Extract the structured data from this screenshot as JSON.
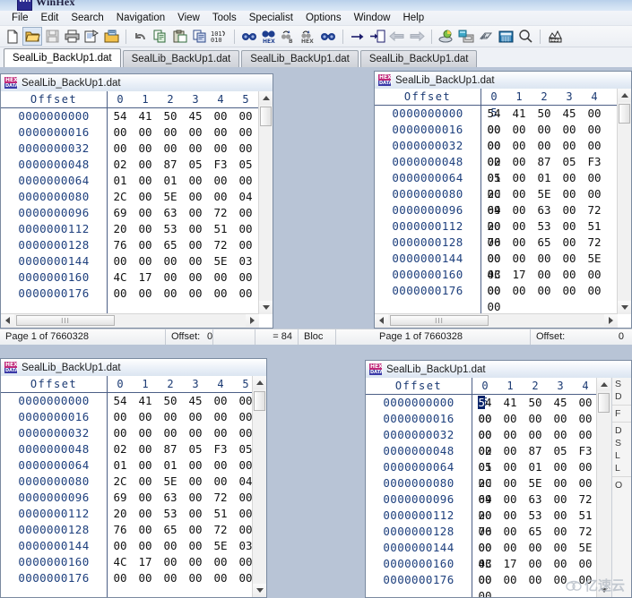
{
  "app": {
    "title": "WinHex",
    "icon": "winhex-app-icon"
  },
  "menu": {
    "items": [
      {
        "label": "File"
      },
      {
        "label": "Edit"
      },
      {
        "label": "Search"
      },
      {
        "label": "Navigation"
      },
      {
        "label": "View"
      },
      {
        "label": "Tools"
      },
      {
        "label": "Specialist"
      },
      {
        "label": "Options"
      },
      {
        "label": "Window"
      },
      {
        "label": "Help"
      }
    ]
  },
  "toolbar": {
    "groups": [
      {
        "buttons": [
          {
            "icon": "new-file-icon",
            "pressed": false
          },
          {
            "icon": "open-folder-icon",
            "pressed": true
          },
          {
            "icon": "save-disk-icon",
            "pressed": false
          },
          {
            "icon": "print-icon",
            "pressed": false
          },
          {
            "icon": "file-properties-icon",
            "pressed": false
          },
          {
            "icon": "open-disk-icon",
            "pressed": false
          }
        ]
      },
      {
        "buttons": [
          {
            "icon": "undo-icon",
            "pressed": false
          },
          {
            "icon": "copy-icon",
            "pressed": false
          },
          {
            "icon": "paste-icon",
            "pressed": false
          },
          {
            "icon": "clipboard-write-icon",
            "pressed": false
          },
          {
            "icon": "binary-101-icon",
            "pressed": false
          }
        ]
      },
      {
        "buttons": [
          {
            "icon": "find-text-icon",
            "pressed": false
          },
          {
            "icon": "find-hex-icon",
            "pressed": false
          },
          {
            "icon": "replace-text-icon",
            "pressed": false
          },
          {
            "icon": "replace-hex-icon",
            "pressed": false
          },
          {
            "icon": "find-again-icon",
            "pressed": false
          }
        ]
      },
      {
        "buttons": [
          {
            "icon": "goto-offset-icon",
            "pressed": false
          },
          {
            "icon": "goto-block-icon",
            "pressed": false
          },
          {
            "icon": "back-arrow-icon",
            "pressed": false
          },
          {
            "icon": "forward-arrow-icon",
            "pressed": false
          }
        ]
      },
      {
        "buttons": [
          {
            "icon": "disk-editor-icon",
            "pressed": false
          },
          {
            "icon": "ram-editor-icon",
            "pressed": false
          },
          {
            "icon": "memory-chip-icon",
            "pressed": false
          },
          {
            "icon": "calculator-icon",
            "pressed": false
          },
          {
            "icon": "magnifier-icon",
            "pressed": false
          }
        ]
      },
      {
        "buttons": [
          {
            "icon": "analysis-icon",
            "pressed": false
          }
        ]
      }
    ]
  },
  "tabs": [
    {
      "label": "SealLib_BackUp1.dat",
      "active": true
    },
    {
      "label": "SealLib_BackUp1.dat",
      "active": false
    },
    {
      "label": "SealLib_BackUp1.dat",
      "active": false
    },
    {
      "label": "SealLib_BackUp1.dat",
      "active": false
    }
  ],
  "hex_view": {
    "offset_header": "Offset",
    "column_headers": [
      "0",
      "1",
      "2",
      "3",
      "4",
      "5"
    ],
    "rows": [
      {
        "offset": "0000000000",
        "bytes": [
          "54",
          "41",
          "50",
          "45",
          "00",
          "00"
        ]
      },
      {
        "offset": "0000000016",
        "bytes": [
          "00",
          "00",
          "00",
          "00",
          "00",
          "00"
        ]
      },
      {
        "offset": "0000000032",
        "bytes": [
          "00",
          "00",
          "00",
          "00",
          "00",
          "00"
        ]
      },
      {
        "offset": "0000000048",
        "bytes": [
          "02",
          "00",
          "87",
          "05",
          "F3",
          "05"
        ]
      },
      {
        "offset": "0000000064",
        "bytes": [
          "01",
          "00",
          "01",
          "00",
          "00",
          "00"
        ]
      },
      {
        "offset": "0000000080",
        "bytes": [
          "2C",
          "00",
          "5E",
          "00",
          "00",
          "04"
        ]
      },
      {
        "offset": "0000000096",
        "bytes": [
          "69",
          "00",
          "63",
          "00",
          "72",
          "00"
        ]
      },
      {
        "offset": "0000000112",
        "bytes": [
          "20",
          "00",
          "53",
          "00",
          "51",
          "00"
        ]
      },
      {
        "offset": "0000000128",
        "bytes": [
          "76",
          "00",
          "65",
          "00",
          "72",
          "00"
        ]
      },
      {
        "offset": "0000000144",
        "bytes": [
          "00",
          "00",
          "00",
          "00",
          "5E",
          "03"
        ]
      },
      {
        "offset": "0000000160",
        "bytes": [
          "4C",
          "17",
          "00",
          "00",
          "00",
          "00"
        ]
      },
      {
        "offset": "0000000176",
        "bytes": [
          "00",
          "00",
          "00",
          "00",
          "00",
          "00"
        ]
      }
    ]
  },
  "windows": [
    {
      "id": "window-top-left",
      "filename": "SealLib_BackUp1.dat",
      "icon": "winhex-doc-icon",
      "active": false,
      "selection": null,
      "visible_rows": 12,
      "status": {
        "page": "Page 1 of 7660328",
        "offset_label": "Offset:",
        "offset_value": "0",
        "equals": "= 84",
        "block": "Bloc"
      }
    },
    {
      "id": "window-top-right",
      "filename": "SealLib_BackUp1.dat",
      "icon": "winhex-doc-icon",
      "active": false,
      "selection": null,
      "visible_rows": 12,
      "status": {
        "page": "Page 1 of 7660328",
        "offset_label": "Offset:",
        "offset_value": "0",
        "equals": "",
        "block": ""
      }
    },
    {
      "id": "window-bottom-left",
      "filename": "SealLib_BackUp1.dat",
      "icon": "winhex-doc-icon",
      "active": false,
      "selection": null,
      "visible_rows": 12,
      "status": null
    },
    {
      "id": "window-bottom-right",
      "filename": "SealLib_BackUp1.dat",
      "icon": "winhex-doc-icon",
      "active": true,
      "selection": {
        "row": 0,
        "byte": 0,
        "nibble": 0
      },
      "visible_rows": 12,
      "status": null
    }
  ],
  "data_interpreter": {
    "lines": [
      "S",
      "D",
      "",
      "F",
      "",
      "D",
      "S",
      "L",
      "L",
      "",
      "O"
    ]
  },
  "scrollbars": {
    "hthumb_grip": "III"
  },
  "watermark": {
    "text": "亿速云",
    "icon": "cloud-logo-icon"
  },
  "colors": {
    "offset_text": "#1d3f7d",
    "hex_text": "#111111",
    "header_text": "#1b3a73",
    "selection_bg": "#0a246a",
    "window_border": "#7a8aa0",
    "mdi_bg": "#b8c4d6",
    "titlebar_gradient_start": "#b9d0ea"
  }
}
